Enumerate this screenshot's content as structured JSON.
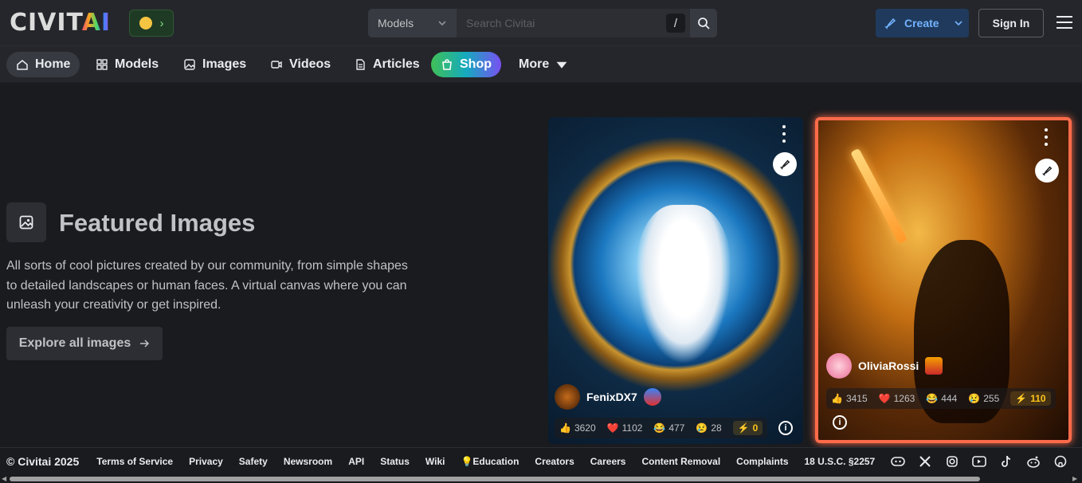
{
  "header": {
    "logo_main": "CIVIT",
    "logo_accent": "AI",
    "search": {
      "scope": "Models",
      "placeholder": "Search Civitai",
      "shortcut": "/"
    },
    "create_label": "Create",
    "signin_label": "Sign In"
  },
  "nav": {
    "items": [
      {
        "label": "Home",
        "icon": "home-icon"
      },
      {
        "label": "Models",
        "icon": "grid-icon"
      },
      {
        "label": "Images",
        "icon": "image-icon"
      },
      {
        "label": "Videos",
        "icon": "video-icon"
      },
      {
        "label": "Articles",
        "icon": "article-icon"
      },
      {
        "label": "Shop",
        "icon": "shopping-bag-icon"
      },
      {
        "label": "More",
        "icon": "caret-down-icon"
      }
    ]
  },
  "hero": {
    "title": "Featured Images",
    "description": "All sorts of cool pictures created by our community, from simple shapes to detailed landscapes or human faces. A virtual canvas where you can unleash your creativity or get inspired.",
    "cta": "Explore all images"
  },
  "cards": [
    {
      "user": "FenixDX7",
      "likes": "3620",
      "hearts": "1102",
      "laughs": "477",
      "cries": "28",
      "buzz": "0"
    },
    {
      "user": "OliviaRossi",
      "likes": "3415",
      "hearts": "1263",
      "laughs": "444",
      "cries": "255",
      "buzz": "110"
    }
  ],
  "footer": {
    "copyright": "© Civitai 2025",
    "links": [
      "Terms of Service",
      "Privacy",
      "Safety",
      "Newsroom",
      "API",
      "Status",
      "Wiki",
      "💡Education",
      "Creators",
      "Careers",
      "Content Removal",
      "Complaints",
      "18 U.S.C. §2257"
    ],
    "social_icons": [
      "discord-icon",
      "x-icon",
      "instagram-icon",
      "youtube-icon",
      "tiktok-icon",
      "reddit-icon",
      "github-icon"
    ]
  },
  "colors": {
    "accent_blue": "#74b3ff",
    "highlight_border": "#ff6b4a",
    "buzz": "#fcc419"
  }
}
